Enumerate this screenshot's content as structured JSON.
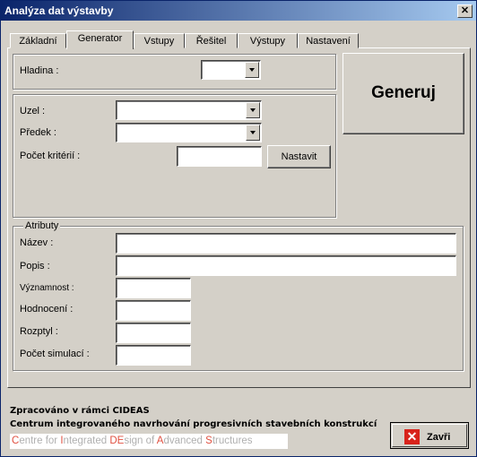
{
  "window": {
    "title": "Analýza dat výstavby",
    "close_glyph": "✕"
  },
  "tabs": [
    {
      "label": "Základní"
    },
    {
      "label": "Generator"
    },
    {
      "label": "Vstupy"
    },
    {
      "label": "Řešitel"
    },
    {
      "label": "Výstupy"
    },
    {
      "label": "Nastavení"
    }
  ],
  "active_tab": "Generator",
  "generator": {
    "hladina_label": "Hladina :",
    "hladina_value": "",
    "generuj_label": "Generuj",
    "uzel_label": "Uzel :",
    "uzel_value": "",
    "predek_label": "Předek :",
    "predek_value": "",
    "pocet_kriterii_label": "Počet kritérií :",
    "pocet_kriterii_value": "",
    "nastavit_label": "Nastavit"
  },
  "atributy": {
    "title": "Atributy",
    "nazev_label": "Název :",
    "nazev_value": "",
    "popis_label": "Popis :",
    "popis_value": "",
    "vyznamnost_label": "Významnost :",
    "vyznamnost_value": "",
    "hodnoceni_label": "Hodnocení :",
    "hodnoceni_value": "",
    "rozptyl_label": "Rozptyl :",
    "rozptyl_value": "",
    "pocet_simulaci_label": "Počet simulací :",
    "pocet_simulaci_value": ""
  },
  "footer": {
    "line1": "Zpracováno v rámci CIDEAS",
    "line2": "Centrum integrovaného navrhování progresivních stavebních konstrukcí",
    "logo_parts": [
      {
        "text": "C",
        "highlight": true
      },
      {
        "text": "entre for ",
        "highlight": false
      },
      {
        "text": "I",
        "highlight": true
      },
      {
        "text": "ntegrated ",
        "highlight": false
      },
      {
        "text": "DE",
        "highlight": true
      },
      {
        "text": "sign of ",
        "highlight": false
      },
      {
        "text": "A",
        "highlight": true
      },
      {
        "text": "dvanced ",
        "highlight": false
      },
      {
        "text": "S",
        "highlight": true
      },
      {
        "text": "tructures",
        "highlight": false
      }
    ],
    "zavri_label": "Zavři"
  },
  "colors": {
    "titlebar_start": "#0a246a",
    "titlebar_end": "#a6caf0",
    "logo_accent": "#e05040",
    "close_icon_bg": "#d8231b"
  }
}
